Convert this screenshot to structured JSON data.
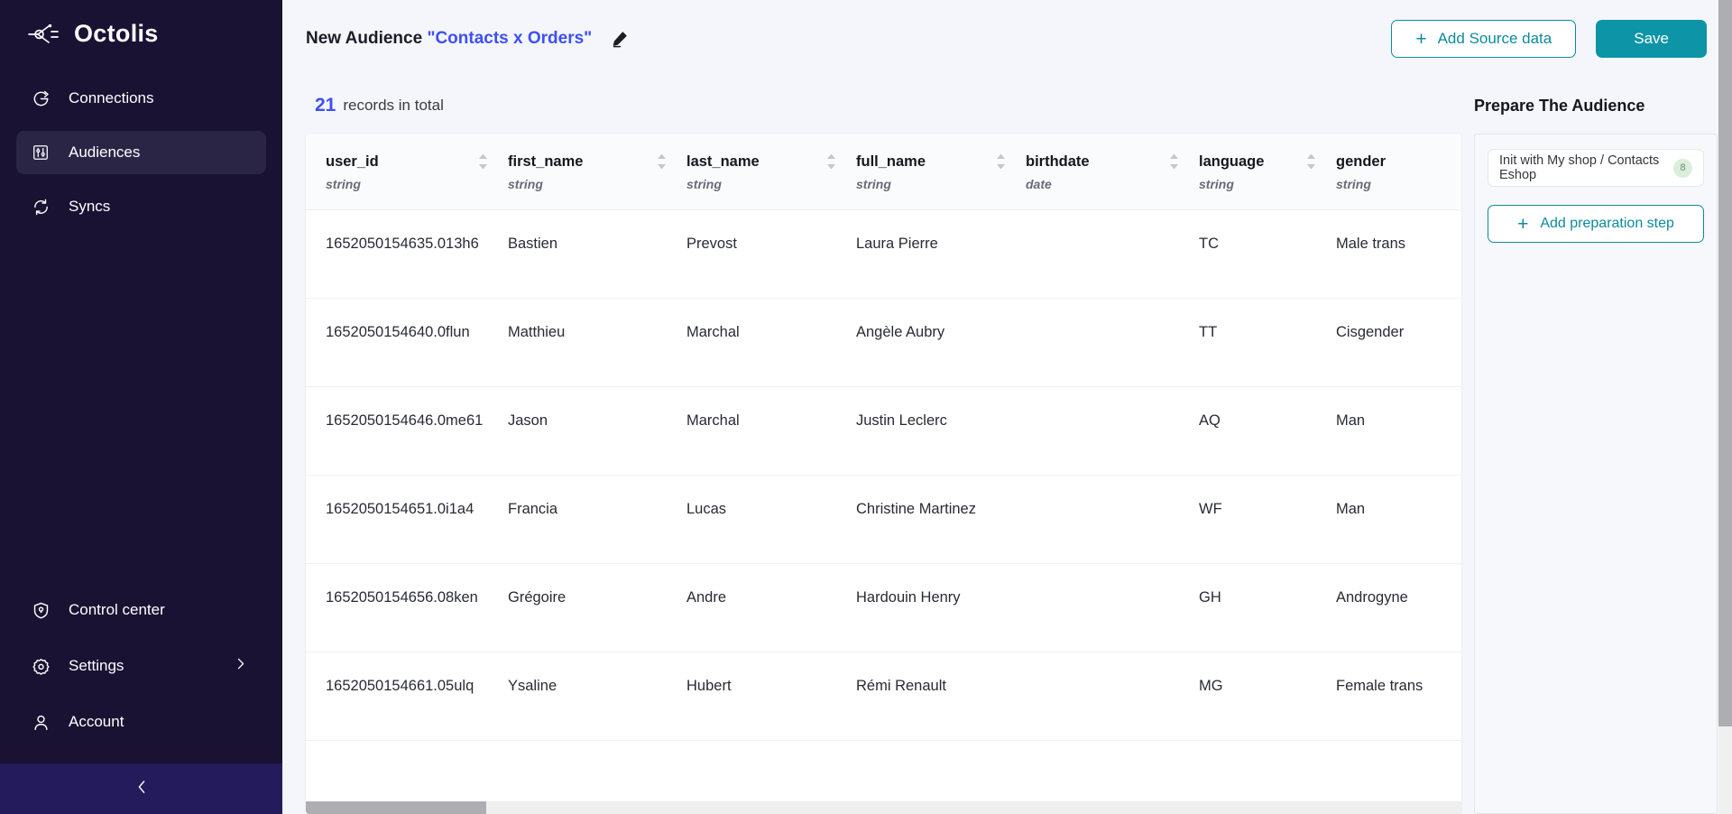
{
  "brand": {
    "name": "Octolis",
    "logo_icon": "octolis-logo-icon"
  },
  "sidebar": {
    "top_items": [
      {
        "label": "Connections",
        "icon": "connections-icon",
        "active": false
      },
      {
        "label": "Audiences",
        "icon": "sliders-icon",
        "active": true
      },
      {
        "label": "Syncs",
        "icon": "refresh-icon",
        "active": false
      }
    ],
    "bottom_items": [
      {
        "label": "Control center",
        "icon": "shield-icon",
        "chevron": false
      },
      {
        "label": "Settings",
        "icon": "gear-icon",
        "chevron": true
      },
      {
        "label": "Account",
        "icon": "user-icon",
        "chevron": false
      }
    ],
    "collapse_icon": "chevron-left-icon"
  },
  "header": {
    "title_prefix": "New Audience",
    "title_quoted": "\"Contacts x Orders\"",
    "edit_icon": "pencil-icon",
    "add_source_label": "Add Source data",
    "save_label": "Save",
    "accent_color": "#0d94a6",
    "link_color": "#3d4ff5"
  },
  "records": {
    "count": "21",
    "label": "records in total"
  },
  "table": {
    "columns": [
      {
        "name": "user_id",
        "type": "string"
      },
      {
        "name": "first_name",
        "type": "string"
      },
      {
        "name": "last_name",
        "type": "string"
      },
      {
        "name": "full_name",
        "type": "string"
      },
      {
        "name": "birthdate",
        "type": "date"
      },
      {
        "name": "language",
        "type": "string"
      },
      {
        "name": "gender",
        "type": "string"
      }
    ],
    "rows": [
      {
        "user_id": "1652050154635.013h6",
        "first_name": "Bastien",
        "last_name": "Prevost",
        "full_name": "Laura Pierre",
        "birthdate": "",
        "language": "TC",
        "gender": "Male trans"
      },
      {
        "user_id": "1652050154640.0flun",
        "first_name": "Matthieu",
        "last_name": "Marchal",
        "full_name": "Angèle Aubry",
        "birthdate": "",
        "language": "TT",
        "gender": "Cisgender"
      },
      {
        "user_id": "1652050154646.0me61",
        "first_name": "Jason",
        "last_name": "Marchal",
        "full_name": "Justin Leclerc",
        "birthdate": "",
        "language": "AQ",
        "gender": "Man"
      },
      {
        "user_id": "1652050154651.0i1a4",
        "first_name": "Francia",
        "last_name": "Lucas",
        "full_name": "Christine Martinez",
        "birthdate": "",
        "language": "WF",
        "gender": "Man"
      },
      {
        "user_id": "1652050154656.08ken",
        "first_name": "Grégoire",
        "last_name": "Andre",
        "full_name": "Hardouin Henry",
        "birthdate": "",
        "language": "GH",
        "gender": "Androgyne"
      },
      {
        "user_id": "1652050154661.05ulq",
        "first_name": "Ysaline",
        "last_name": "Hubert",
        "full_name": "Rémi Renault",
        "birthdate": "",
        "language": "MG",
        "gender": "Female trans"
      }
    ]
  },
  "prepare_panel": {
    "title": "Prepare The Audience",
    "step_label": "Init with My shop / Contacts Eshop",
    "step_badge": "8",
    "add_step_label": "Add preparation step",
    "badge_color": "#dbeedd"
  }
}
